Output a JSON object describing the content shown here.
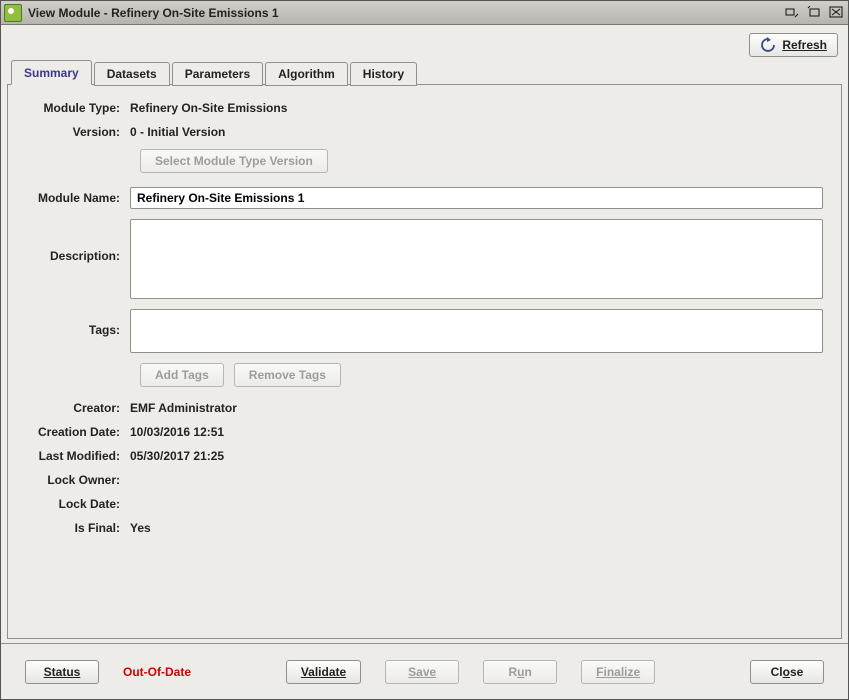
{
  "titlebar": {
    "title": "View Module - Refinery On-Site Emissions 1"
  },
  "toolbar": {
    "refresh_label": "Refresh"
  },
  "tabs": {
    "summary": "Summary",
    "datasets": "Datasets",
    "parameters": "Parameters",
    "algorithm": "Algorithm",
    "history": "History"
  },
  "form": {
    "labels": {
      "module_type": "Module Type:",
      "version": "Version:",
      "module_name": "Module Name:",
      "description": "Description:",
      "tags": "Tags:",
      "creator": "Creator:",
      "creation_date": "Creation Date:",
      "last_modified": "Last Modified:",
      "lock_owner": "Lock Owner:",
      "lock_date": "Lock Date:",
      "is_final": "Is Final:"
    },
    "values": {
      "module_type": "Refinery On-Site Emissions",
      "version": "0 - Initial Version",
      "module_name": "Refinery On-Site Emissions 1",
      "description": "",
      "tags": "",
      "creator": "EMF Administrator",
      "creation_date": "10/03/2016 12:51",
      "last_modified": "05/30/2017 21:25",
      "lock_owner": "",
      "lock_date": "",
      "is_final": "Yes"
    },
    "buttons": {
      "select_version": "Select Module Type Version",
      "add_tags": "Add Tags",
      "remove_tags": "Remove Tags"
    }
  },
  "footer": {
    "status_btn": "Status",
    "status_text": "Out-Of-Date",
    "validate": "Validate",
    "save": "Save",
    "run": "Run",
    "finalize": "Finalize",
    "close": "Close"
  }
}
